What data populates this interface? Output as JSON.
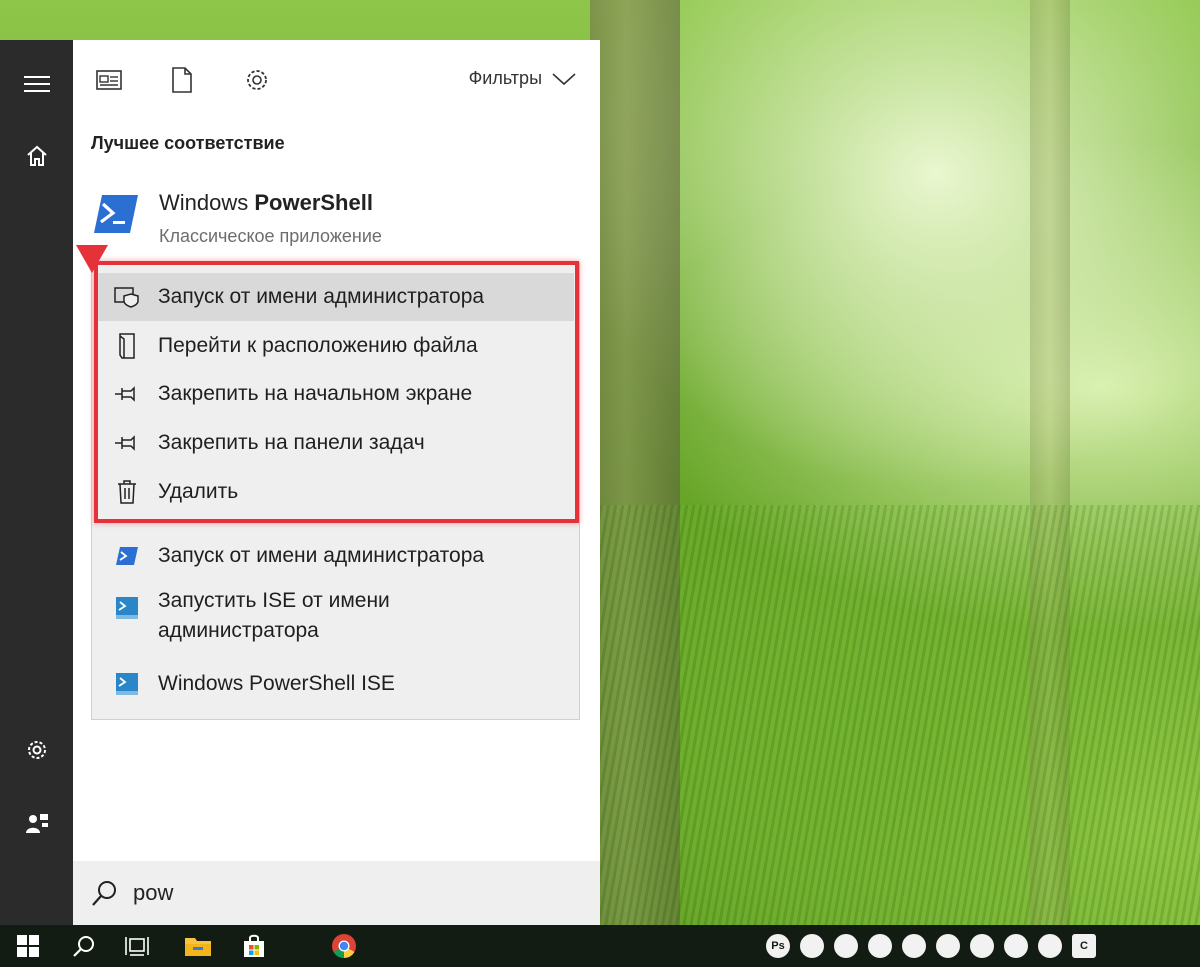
{
  "filters": {
    "label": "Фильтры"
  },
  "best_match": {
    "section_title": "Лучшее соответствие",
    "app_name_prefix": "Windows ",
    "app_name_bold": "PowerShell",
    "app_type": "Классическое приложение"
  },
  "context_menu": [
    {
      "label": "Запуск от имени администратора",
      "icon": "shield-icon"
    },
    {
      "label": "Перейти к расположению файла",
      "icon": "file-location-icon"
    },
    {
      "label": "Закрепить на начальном экране",
      "icon": "pin-icon"
    },
    {
      "label": "Закрепить на панели задач",
      "icon": "pin-icon"
    },
    {
      "label": "Удалить",
      "icon": "trash-icon"
    }
  ],
  "actions": [
    {
      "label": "Запуск от имени администратора",
      "icon": "powershell-icon"
    },
    {
      "label_line1": "Запустить ISE от имени",
      "label_line2": "администратора",
      "icon": "powershell-ise-icon"
    },
    {
      "label": "Windows PowerShell ISE",
      "icon": "powershell-ise-icon"
    }
  ],
  "search": {
    "query": "pow"
  },
  "tray": [
    "Ps",
    "send",
    "img",
    "chrome",
    "ff",
    "eye",
    "layers",
    "box",
    "play",
    "C"
  ],
  "colors": {
    "highlight": "#e5323a",
    "powershell": "#2a6fd1",
    "rail": "#2b2b2b",
    "taskbar": "#121c12"
  }
}
